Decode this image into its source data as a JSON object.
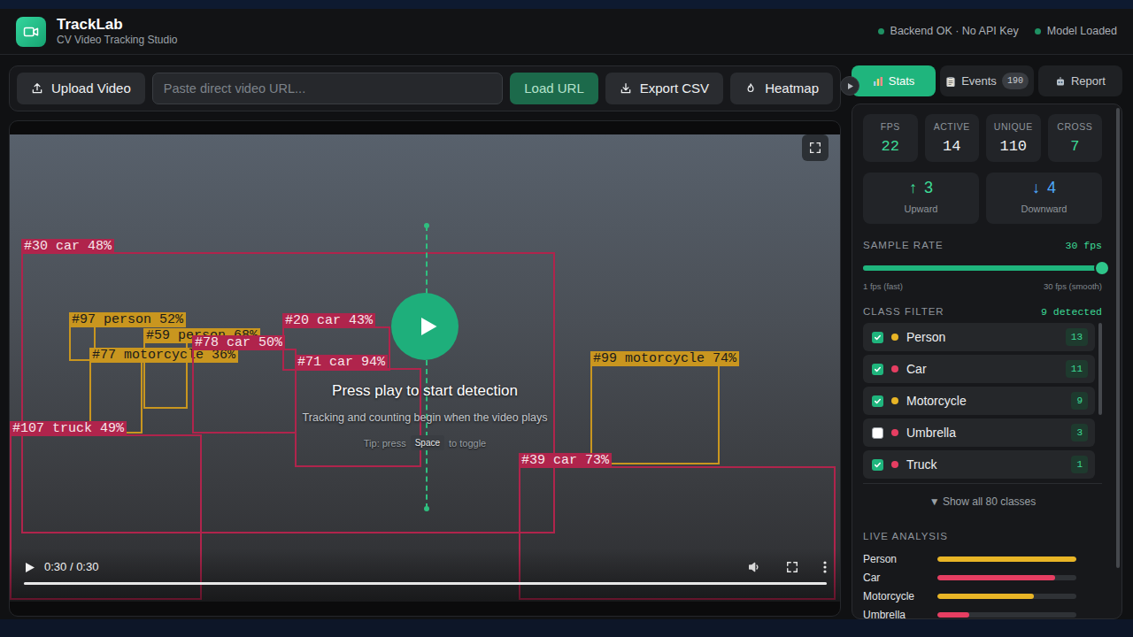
{
  "app": {
    "title": "TrackLab",
    "subtitle": "CV Video Tracking Studio"
  },
  "status": [
    {
      "label": "Backend OK · No API Key"
    },
    {
      "label": "Model Loaded"
    }
  ],
  "toolbar": {
    "upload": "Upload Video",
    "url_placeholder": "Paste direct video URL...",
    "load": "Load URL",
    "export": "Export CSV",
    "heatmap": "Heatmap"
  },
  "video": {
    "detections": [
      {
        "label": "#30 car 48%",
        "color": "#b0244c"
      },
      {
        "label": "#97 person 52%",
        "color": "#c9961f"
      },
      {
        "label": "#59 person 68%",
        "color": "#c9961f"
      },
      {
        "label": "#77 motorcycle 36%",
        "color": "#c9961f"
      },
      {
        "label": "#78 car 50%",
        "color": "#b0244c"
      },
      {
        "label": "#20 car 43%",
        "color": "#b0244c"
      },
      {
        "label": "#71 car 94%",
        "color": "#b0244c"
      },
      {
        "label": "#99 motorcycle 74%",
        "color": "#c9961f"
      },
      {
        "label": "#107 truck 49%",
        "color": "#b0244c"
      },
      {
        "label": "#39 car 73%",
        "color": "#b0244c"
      }
    ],
    "overlay": {
      "title": "Press play to start detection",
      "subtitle": "Tracking and counting begin when the video plays",
      "tip_before": "Tip: press",
      "tip_key": "Space",
      "tip_after": "to toggle"
    },
    "controls": {
      "time": "0:30 / 0:30",
      "progress": 1
    }
  },
  "tabs": [
    {
      "label": "Stats",
      "selected": true
    },
    {
      "label": "Events",
      "badge": "190",
      "selected": false
    },
    {
      "label": "Report",
      "selected": false
    }
  ],
  "stats": [
    {
      "label": "FPS",
      "value": "22",
      "color": "#3ddc97"
    },
    {
      "label": "ACTIVE",
      "value": "14",
      "color": "#eef0f2"
    },
    {
      "label": "UNIQUE",
      "value": "110",
      "color": "#eef0f2"
    },
    {
      "label": "CROSS",
      "value": "7",
      "color": "#3ddc97"
    }
  ],
  "directions": [
    {
      "arrow": "↑",
      "value": "3",
      "label": "Upward",
      "color": "#3ddc97"
    },
    {
      "arrow": "↓",
      "value": "4",
      "label": "Downward",
      "color": "#4ea9ff"
    }
  ],
  "sample_rate": {
    "title": "SAMPLE RATE",
    "value": "30 fps",
    "level": 1,
    "min_label": "1 fps (fast)",
    "max_label": "30 fps (smooth)"
  },
  "class_filter": {
    "title": "CLASS FILTER",
    "summary": "9 detected",
    "items": [
      {
        "name": "Person",
        "count": "13",
        "checked": true,
        "color": "#e8b526"
      },
      {
        "name": "Car",
        "count": "11",
        "checked": true,
        "color": "#e63e62"
      },
      {
        "name": "Motorcycle",
        "count": "9",
        "checked": true,
        "color": "#e8b526"
      },
      {
        "name": "Umbrella",
        "count": "3",
        "checked": false,
        "color": "#e63e62"
      },
      {
        "name": "Truck",
        "count": "1",
        "checked": true,
        "color": "#e63e62"
      }
    ],
    "show_all": "▼ Show all 80 classes"
  },
  "live_analysis": {
    "title": "LIVE ANALYSIS",
    "bars": [
      {
        "label": "Person",
        "value": 13,
        "color": "#e8b526"
      },
      {
        "label": "Car",
        "value": 11,
        "color": "#e63e62"
      },
      {
        "label": "Motorcycle",
        "value": 9,
        "color": "#e8b526"
      },
      {
        "label": "Umbrella",
        "value": 3,
        "color": "#e63e62"
      }
    ]
  }
}
